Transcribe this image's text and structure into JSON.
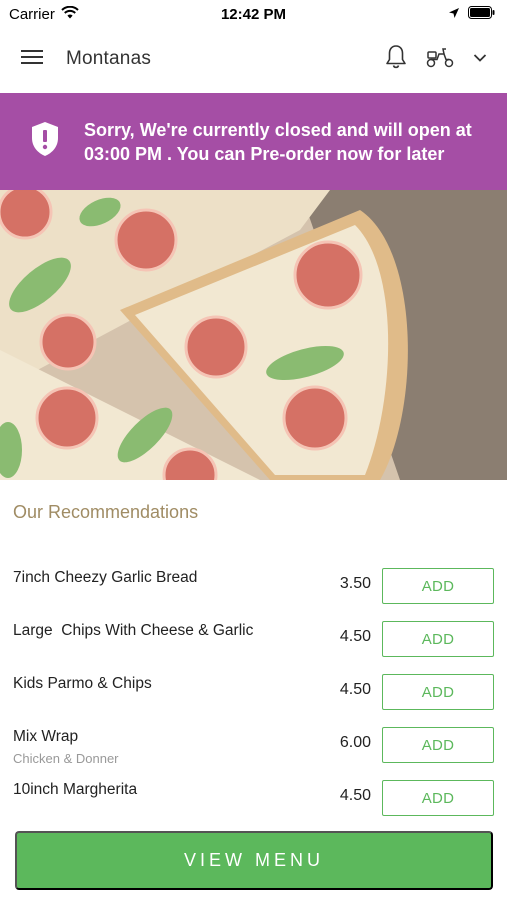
{
  "status_bar": {
    "carrier": "Carrier",
    "time": "12:42 PM"
  },
  "nav": {
    "title": "Montanas",
    "icons": [
      "menu-icon",
      "bell-icon",
      "scooter-icon",
      "chevron-down-icon"
    ]
  },
  "banner": {
    "message": "Sorry, We're currently closed and will open at 03:00 PM . You can Pre-order now for later",
    "color": "#a54ea5",
    "icon": "shield-alert-icon"
  },
  "hero": {
    "image": "pizza-margherita-photo"
  },
  "recommendations": {
    "title": "Our Recommendations",
    "items": [
      {
        "name": "7inch Cheezy Garlic Bread",
        "subtitle": "",
        "price": "3.50",
        "button": "ADD"
      },
      {
        "name": "Large  Chips With Cheese & Garlic",
        "subtitle": "",
        "price": "4.50",
        "button": "ADD"
      },
      {
        "name": "Kids Parmo & Chips",
        "subtitle": "",
        "price": "4.50",
        "button": "ADD"
      },
      {
        "name": "Mix Wrap",
        "subtitle": "Chicken & Donner",
        "price": "6.00",
        "button": "ADD"
      },
      {
        "name": "10inch Margherita",
        "subtitle": "",
        "price": "4.50",
        "button": "ADD"
      }
    ]
  },
  "cta": {
    "label": "VIEW MENU",
    "color": "#5cb85c"
  }
}
